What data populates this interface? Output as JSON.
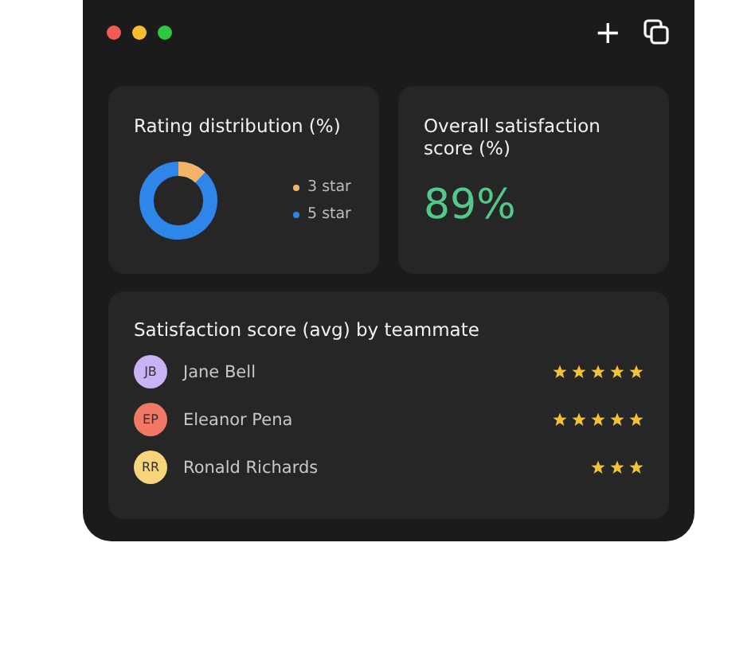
{
  "window": {
    "controls": [
      {
        "color": "#f25a55"
      },
      {
        "color": "#f6bc2f"
      },
      {
        "color": "#2cc840"
      }
    ],
    "toolbar": [
      "+"
    ]
  },
  "rating_card": {
    "title": "Rating distribution (%)",
    "legend": [
      {
        "label": "3 star",
        "color": "#f3b46a"
      },
      {
        "label": "5 star",
        "color": "#2f86ea"
      }
    ]
  },
  "score_card": {
    "title": "Overall satisfaction score (%)",
    "value": "89%"
  },
  "teammates_card": {
    "title": "Satisfaction score (avg) by teammate",
    "rows": [
      {
        "initials": "JB",
        "name": "Jane Bell",
        "color": "#c9b2f5",
        "stars": 5
      },
      {
        "initials": "EP",
        "name": "Eleanor Pena",
        "color": "#f07864",
        "stars": 5
      },
      {
        "initials": "RR",
        "name": "Ronald Richards",
        "color": "#f8d57a",
        "stars": 3
      }
    ]
  }
}
